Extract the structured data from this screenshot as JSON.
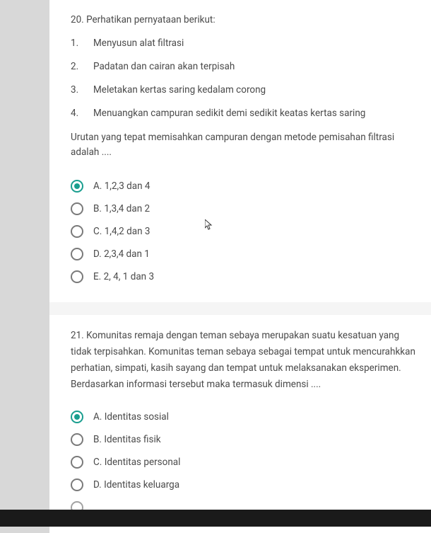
{
  "q20": {
    "header": "20. Perhatikan pernyataan berikut:",
    "items": [
      {
        "num": "1.",
        "text": "Menyusun alat filtrasi"
      },
      {
        "num": "2.",
        "text": "Padatan dan cairan akan terpisah"
      },
      {
        "num": "3.",
        "text": "Meletakan kertas saring kedalam corong"
      },
      {
        "num": "4.",
        "text": "Menuangkan campuran sedikit demi sedikit keatas kertas saring"
      }
    ],
    "prompt": "Urutan yang tepat memisahkan campuran dengan metode pemisahan filtrasi adalah ....",
    "options": [
      {
        "label": "A. 1,2,3 dan 4",
        "selected": true
      },
      {
        "label": "B. 1,3,4 dan 2",
        "selected": false
      },
      {
        "label": "C. 1,4,2 dan 3",
        "selected": false
      },
      {
        "label": "D. 2,3,4 dan 1",
        "selected": false
      },
      {
        "label": "E. 2, 4, 1 dan 3",
        "selected": false
      }
    ]
  },
  "q21": {
    "text": "21. Komunitas remaja dengan teman sebaya merupakan suatu kesatuan yang tidak terpisahkan. Komunitas teman sebaya sebagai tempat untuk mencurahkkan perhatian, simpati, kasih sayang dan tempat untuk melaksanakan eksperimen. Berdasarkan informasi tersebut maka termasuk dimensi ....",
    "options": [
      {
        "label": "A. Identitas sosial",
        "selected": true
      },
      {
        "label": "B. Identitas fisik",
        "selected": false
      },
      {
        "label": "C. Identitas personal",
        "selected": false
      },
      {
        "label": "D. Identitas keluarga",
        "selected": false
      }
    ]
  }
}
